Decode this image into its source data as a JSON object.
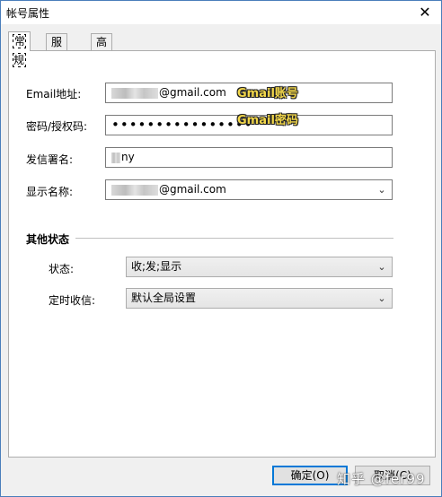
{
  "window": {
    "title": "帐号属性",
    "close_glyph": "✕"
  },
  "tabs": [
    {
      "label": "常规",
      "active": true
    },
    {
      "label": "服务器",
      "active": false
    },
    {
      "label": "高级",
      "active": false
    }
  ],
  "form": {
    "email_label": "Email地址:",
    "email_value": "@gmail.com",
    "email_note": "Gmail账号",
    "password_label": "密码/授权码:",
    "password_value": "••••••••••••••••",
    "password_note": "Gmail密码",
    "signature_label": "发信署名:",
    "signature_value": "ny",
    "display_name_label": "显示名称:",
    "display_name_value": "@gmail.com"
  },
  "other_status": {
    "title": "其他状态",
    "status_label": "状态:",
    "status_value": "收;发;显示",
    "schedule_label": "定时收信:",
    "schedule_value": "默认全局设置"
  },
  "buttons": {
    "ok": "确定(O)",
    "cancel": "取消(C)"
  },
  "watermark": "知乎 @fer99",
  "colors": {
    "note_fill": "#f2d74a",
    "focus_border": "#0078d7"
  }
}
